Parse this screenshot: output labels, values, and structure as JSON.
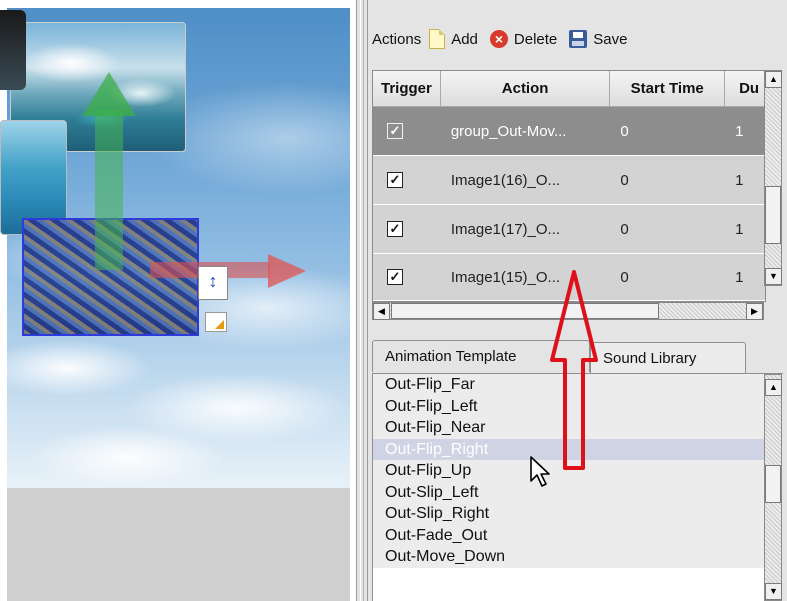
{
  "toolbar": {
    "label": "Actions",
    "add_label": "Add",
    "delete_label": "Delete",
    "save_label": "Save",
    "add_icon": "new-page-icon",
    "delete_icon": "delete-x-icon",
    "save_icon": "floppy-disk-icon"
  },
  "table": {
    "columns": [
      "Trigger",
      "Action",
      "Start Time",
      "Du"
    ],
    "rows": [
      {
        "trigger_checked": true,
        "action": "group_Out-Mov...",
        "start": "0",
        "duration": "1",
        "selected": true
      },
      {
        "trigger_checked": true,
        "action": "Image1(16)_O...",
        "start": "0",
        "duration": "1",
        "selected": false
      },
      {
        "trigger_checked": true,
        "action": "Image1(17)_O...",
        "start": "0",
        "duration": "1",
        "selected": false
      },
      {
        "trigger_checked": true,
        "action": "Image1(15)_O...",
        "start": "0",
        "duration": "1",
        "selected": false
      }
    ]
  },
  "tabs": {
    "animation": "Animation Template",
    "sound": "Sound Library"
  },
  "templates": {
    "items": [
      "Out-Flip_Far",
      "Out-Flip_Left",
      "Out-Flip_Near",
      "Out-Flip_Right",
      "Out-Flip_Up",
      "Out-Slip_Left",
      "Out-Slip_Right",
      "Out-Fade_Out",
      "Out-Move_Down"
    ],
    "highlighted": "Out-Flip_Right"
  },
  "colors": {
    "selected_row": "#8d8d8d",
    "annotation_arrow": "#e0101a",
    "selection_border": "#2a3ad8"
  }
}
